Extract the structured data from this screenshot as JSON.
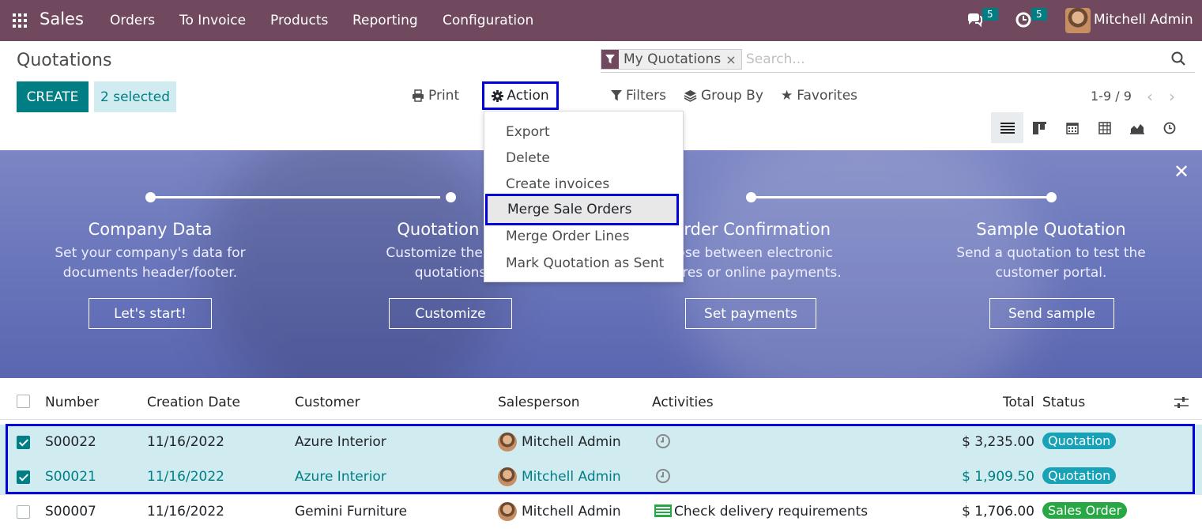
{
  "navbar": {
    "brand": "Sales",
    "menu": [
      "Orders",
      "To Invoice",
      "Products",
      "Reporting",
      "Configuration"
    ],
    "messages_count": "5",
    "activities_count": "5",
    "user": "Mitchell Admin"
  },
  "control_panel": {
    "title": "Quotations",
    "create_label": "CREATE",
    "selected_label": "2 selected",
    "print_label": "Print",
    "action_label": "Action",
    "search": {
      "facet": "My Quotations",
      "placeholder": "Search..."
    },
    "filters_label": "Filters",
    "group_by_label": "Group By",
    "favorites_label": "Favorites",
    "pager": "1-9 / 9",
    "views": [
      "list-view-icon",
      "kanban-view-icon",
      "calendar-view-icon",
      "pivot-view-icon",
      "graph-view-icon",
      "activity-view-icon"
    ]
  },
  "action_menu": {
    "items": [
      "Export",
      "Delete",
      "Create invoices",
      "Merge Sale Orders",
      "Merge Order Lines",
      "Mark Quotation as Sent"
    ],
    "highlighted": "Merge Sale Orders"
  },
  "banner": {
    "steps": [
      {
        "title": "Company Data",
        "desc1": "Set your company's data for",
        "desc2": "documents header/footer.",
        "button": "Let's start!"
      },
      {
        "title": "Quotation La",
        "desc1": "Customize the look",
        "desc2": "quotations",
        "button": "Customize"
      },
      {
        "title": "Order Confirmation",
        "desc1": "oose between electronic",
        "desc2": "atures or online payments.",
        "button": "Set payments"
      },
      {
        "title": "Sample Quotation",
        "desc1": "Send a quotation to test the",
        "desc2": "customer portal.",
        "button": "Send sample"
      }
    ]
  },
  "table": {
    "columns": {
      "number": "Number",
      "creation_date": "Creation Date",
      "customer": "Customer",
      "salesperson": "Salesperson",
      "activities": "Activities",
      "total": "Total",
      "status": "Status"
    },
    "rows": [
      {
        "number": "S00022",
        "date": "11/16/2022",
        "customer": "Azure Interior",
        "salesperson": "Mitchell Admin",
        "activity": "",
        "total": "$ 3,235.00",
        "status": "Quotation",
        "selected": true
      },
      {
        "number": "S00021",
        "date": "11/16/2022",
        "customer": "Azure Interior",
        "salesperson": "Mitchell Admin",
        "activity": "",
        "total": "$ 1,909.50",
        "status": "Quotation",
        "selected": true
      },
      {
        "number": "S00007",
        "date": "11/16/2022",
        "customer": "Gemini Furniture",
        "salesperson": "Mitchell Admin",
        "activity": "Check delivery requirements",
        "total": "$ 1,706.00",
        "status": "Sales Order",
        "selected": false
      }
    ]
  },
  "colors": {
    "navbar": "#71495f",
    "primary": "#017e84",
    "quotation_badge": "#17a2b8",
    "sales_order_badge": "#28a745",
    "highlight_outline": "#0000dd"
  }
}
